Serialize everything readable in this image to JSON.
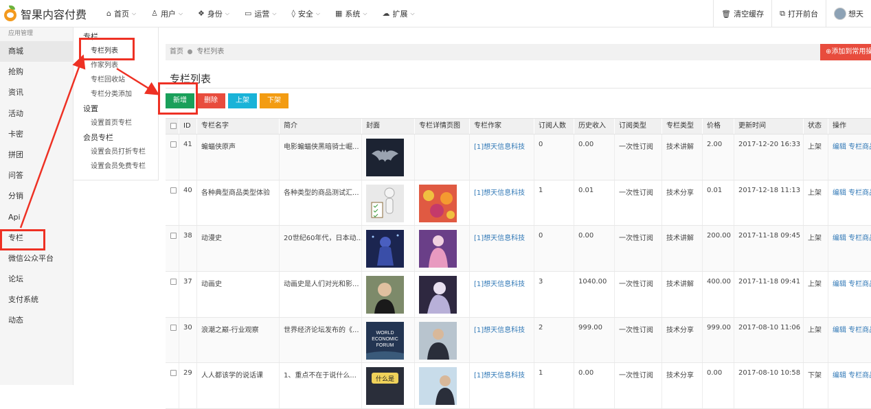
{
  "app": {
    "title": "智果内容付费"
  },
  "nav": [
    {
      "icon": "home-icon",
      "glyph": "⌂",
      "label": "首页"
    },
    {
      "icon": "user-icon",
      "glyph": "♙",
      "label": "用户"
    },
    {
      "icon": "group-icon",
      "glyph": "❖",
      "label": "身份"
    },
    {
      "icon": "monitor-icon",
      "glyph": "▭",
      "label": "运营"
    },
    {
      "icon": "shield-icon",
      "glyph": "◊",
      "label": "安全"
    },
    {
      "icon": "windows-icon",
      "glyph": "▦",
      "label": "系统"
    },
    {
      "icon": "cloud-icon",
      "glyph": "☁",
      "label": "扩展"
    }
  ],
  "topright": {
    "clear_cache": "清空缓存",
    "open_front": "打开前台",
    "user": "想天"
  },
  "sidebar": {
    "header": "应用管理",
    "items": [
      "商城",
      "抢购",
      "资讯",
      "活动",
      "卡密",
      "拼团",
      "问答",
      "分销",
      "Api",
      "专栏",
      "微信公众平台",
      "论坛",
      "支付系统",
      "动态"
    ]
  },
  "submenu": {
    "group1": "专栏",
    "links1": [
      "专栏列表",
      "作家列表",
      "专栏回收站",
      "专栏分类添加"
    ],
    "group2": "设置",
    "links2": [
      "设置首页专栏"
    ],
    "group3": "会员专栏",
    "links3": [
      "设置会员打折专栏",
      "设置会员免费专栏"
    ]
  },
  "breadcrumb": {
    "home": "首页",
    "current": "专栏列表"
  },
  "add_favorite": "⊕添加到常用操作",
  "page_title": "专栏列表",
  "toolbar": {
    "add": "新增",
    "delete": "删除",
    "up": "上架",
    "down": "下架"
  },
  "table": {
    "headers": [
      "ID",
      "专栏名字",
      "简介",
      "封面",
      "专栏详情页图",
      "专栏作家",
      "订阅人数",
      "历史收入",
      "订阅类型",
      "专栏类型",
      "价格",
      "更新时间",
      "状态",
      "操作"
    ],
    "rows": [
      {
        "id": "41",
        "name": "蝙蝠侠原声",
        "desc": "电影蝙蝠侠黑暗骑士崛...",
        "author": "[1]想天信息科技",
        "subs": "0",
        "income": "0.00",
        "sub_type": "一次性订阅",
        "col_type": "技术讲解",
        "price": "2.00",
        "updated": "2017-12-20 16:33",
        "status": "上架",
        "ops": "编辑 专栏商品"
      },
      {
        "id": "40",
        "name": "各种典型商品类型体验",
        "desc": "各种类型的商品测试汇...",
        "author": "[1]想天信息科技",
        "subs": "1",
        "income": "0.01",
        "sub_type": "一次性订阅",
        "col_type": "技术分享",
        "price": "0.01",
        "updated": "2017-12-18 11:13",
        "status": "上架",
        "ops": "编辑 专栏商品"
      },
      {
        "id": "38",
        "name": "动漫史",
        "desc": "20世纪60年代，日本动...",
        "author": "[1]想天信息科技",
        "subs": "0",
        "income": "0.00",
        "sub_type": "一次性订阅",
        "col_type": "技术讲解",
        "price": "200.00",
        "updated": "2017-11-18 09:45",
        "status": "上架",
        "ops": "编辑 专栏商品"
      },
      {
        "id": "37",
        "name": "动画史",
        "desc": "动画史是人们对光和影...",
        "author": "[1]想天信息科技",
        "subs": "3",
        "income": "1040.00",
        "sub_type": "一次性订阅",
        "col_type": "技术讲解",
        "price": "400.00",
        "updated": "2017-11-18 09:41",
        "status": "上架",
        "ops": "编辑 专栏商品"
      },
      {
        "id": "30",
        "name": "浪潮之巅-行业观察",
        "desc": "世界经济论坛发布的《...",
        "author": "[1]想天信息科技",
        "subs": "2",
        "income": "999.00",
        "sub_type": "一次性订阅",
        "col_type": "技术分享",
        "price": "999.00",
        "updated": "2017-08-10 11:06",
        "status": "上架",
        "ops": "编辑 专栏商品"
      },
      {
        "id": "29",
        "name": "人人都该学的说话课",
        "desc": "1、重点不在于说什么...",
        "author": "[1]想天信息科技",
        "subs": "1",
        "income": "0.00",
        "sub_type": "一次性订阅",
        "col_type": "技术分享",
        "price": "0.00",
        "updated": "2017-08-10 10:58",
        "status": "下架",
        "ops": "编辑 专栏商品"
      }
    ]
  },
  "images": {
    "cover_texts": {
      "r30": [
        "WORLD",
        "ECONOMIC",
        "FORUM"
      ],
      "r29": "什么是"
    },
    "colors": {
      "cover": [
        "#1c2332",
        "#e9e9e9",
        "#2a3a6e",
        "#6a7a60",
        "#233552",
        "#c47a2a"
      ],
      "detail": [
        null,
        "#d84c3f",
        "#7a4c8e",
        "#3a3048",
        "#9aa7b4",
        "#a9c6d8"
      ]
    }
  },
  "colors": {
    "add": "#1aa05a",
    "delete": "#e84c3d",
    "up": "#1ab3d8",
    "down": "#f39c12",
    "link": "#337ab7",
    "annotation": "#ee3124"
  }
}
